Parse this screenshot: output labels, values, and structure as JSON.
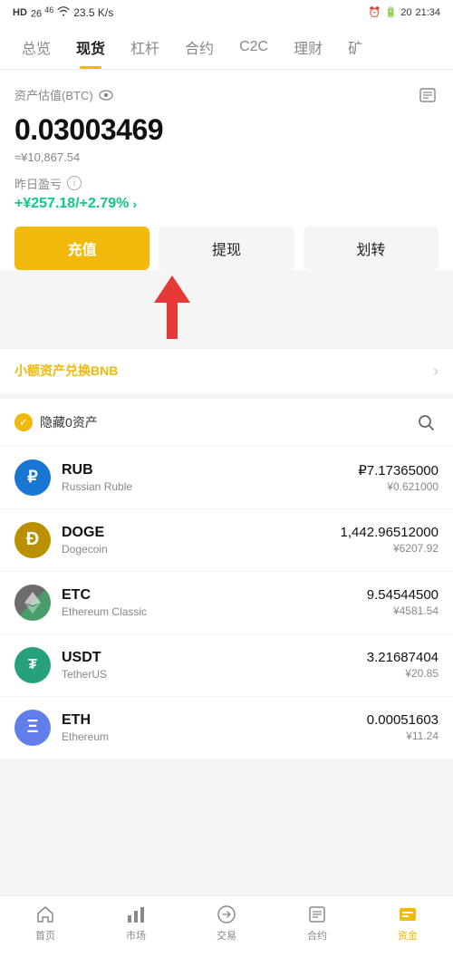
{
  "statusBar": {
    "left": "HD 26 46",
    "signal": "WiFi",
    "speed": "23.5 K/s",
    "battery": "20",
    "time": "21:34"
  },
  "navTabs": [
    {
      "id": "overview",
      "label": "总览",
      "active": false
    },
    {
      "id": "spot",
      "label": "现货",
      "active": true
    },
    {
      "id": "leverage",
      "label": "杠杆",
      "active": false
    },
    {
      "id": "contract",
      "label": "合约",
      "active": false
    },
    {
      "id": "c2c",
      "label": "C2C",
      "active": false
    },
    {
      "id": "finance",
      "label": "理财",
      "active": false
    },
    {
      "id": "mining",
      "label": "矿",
      "active": false
    }
  ],
  "asset": {
    "label": "资产估值(BTC)",
    "btcValue": "0.03003469",
    "btcCny": "≈¥10,867.54",
    "pnlLabel": "昨日盈亏",
    "pnlValue": "+¥257.18/+2.79%"
  },
  "buttons": {
    "deposit": "充值",
    "withdraw": "提现",
    "transfer": "划转"
  },
  "smallAssets": {
    "text": "小额资产兑换",
    "highlight": "BNB"
  },
  "filter": {
    "hideZeroLabel": "隐藏0资产"
  },
  "coins": [
    {
      "id": "rub",
      "symbol": "RUB",
      "name": "Russian Ruble",
      "icon": "₽",
      "iconClass": "rub",
      "balance": "₽7.17365000",
      "cny": "¥0.621000"
    },
    {
      "id": "doge",
      "symbol": "DOGE",
      "name": "Dogecoin",
      "icon": "D",
      "iconClass": "doge",
      "balance": "1,442.96512000",
      "cny": "¥6207.92"
    },
    {
      "id": "etc",
      "symbol": "ETC",
      "name": "Ethereum Classic",
      "icon": "◆",
      "iconClass": "etc",
      "balance": "9.54544500",
      "cny": "¥4581.54"
    },
    {
      "id": "usdt",
      "symbol": "USDT",
      "name": "TetherUS",
      "icon": "T",
      "iconClass": "usdt",
      "balance": "3.21687404",
      "cny": "¥20.85"
    },
    {
      "id": "eth",
      "symbol": "ETH",
      "name": "Ethereum",
      "icon": "Ξ",
      "iconClass": "eth",
      "balance": "0.00051603",
      "cny": "¥11.24"
    }
  ],
  "bottomNav": [
    {
      "id": "home",
      "label": "首页",
      "active": false
    },
    {
      "id": "market",
      "label": "市场",
      "active": false
    },
    {
      "id": "trade",
      "label": "交易",
      "active": false
    },
    {
      "id": "contract",
      "label": "合约",
      "active": false
    },
    {
      "id": "assets",
      "label": "资金",
      "active": true
    }
  ]
}
